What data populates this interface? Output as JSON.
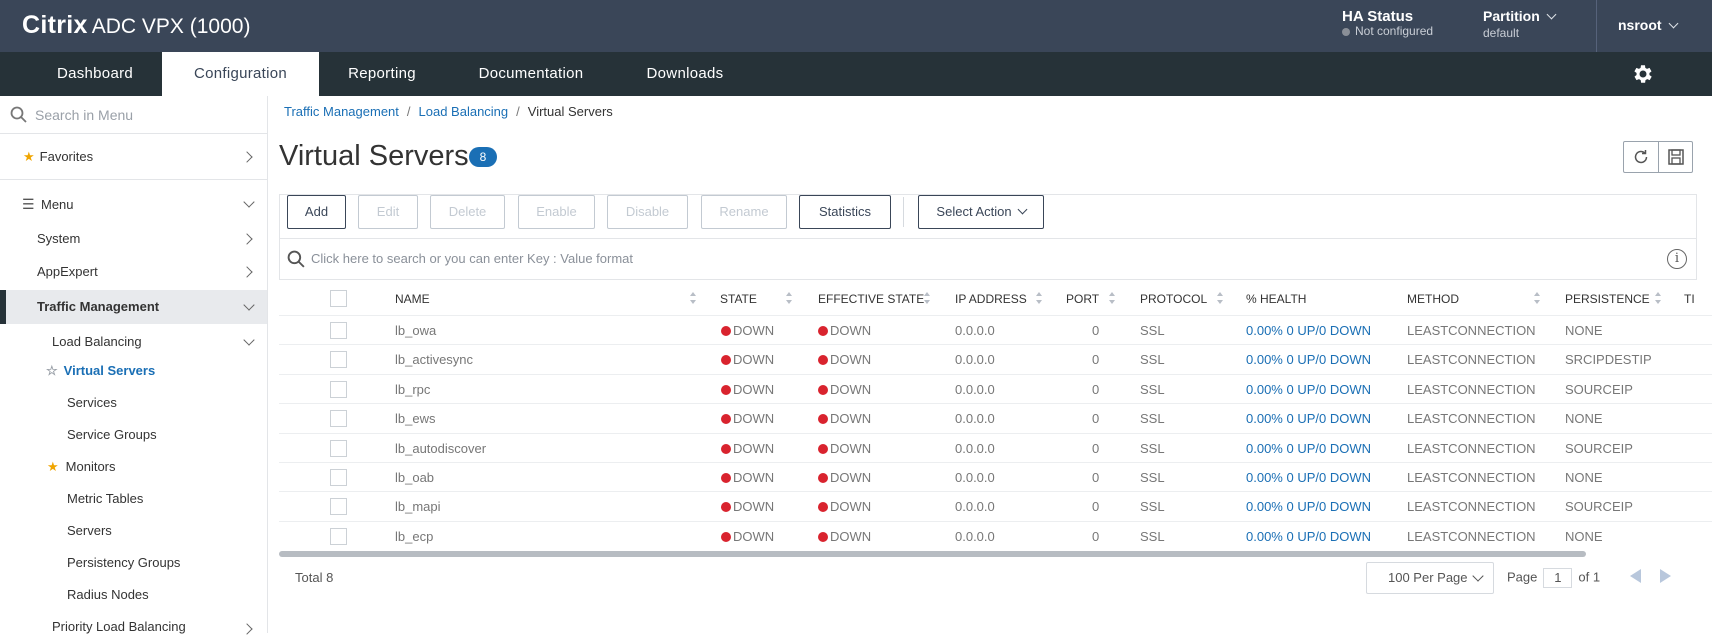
{
  "header": {
    "brand_bold": "Citrix",
    "brand_rest": "ADC VPX (1000)",
    "ha_title": "HA Status",
    "ha_value": "Not configured",
    "partition_title": "Partition",
    "partition_value": "default",
    "user": "nsroot"
  },
  "nav": {
    "tabs": [
      {
        "label": "Dashboard"
      },
      {
        "label": "Configuration"
      },
      {
        "label": "Reporting"
      },
      {
        "label": "Documentation"
      },
      {
        "label": "Downloads"
      }
    ],
    "active": "Configuration"
  },
  "sidebar": {
    "search_placeholder": "Search in Menu",
    "favorites": "Favorites",
    "menu": "Menu",
    "items": [
      {
        "label": "System"
      },
      {
        "label": "AppExpert"
      },
      {
        "label": "Traffic Management"
      },
      {
        "label": "Load Balancing"
      },
      {
        "label": "Virtual Servers"
      },
      {
        "label": "Services"
      },
      {
        "label": "Service Groups"
      },
      {
        "label": "Monitors"
      },
      {
        "label": "Metric Tables"
      },
      {
        "label": "Servers"
      },
      {
        "label": "Persistency Groups"
      },
      {
        "label": "Radius Nodes"
      },
      {
        "label": "Priority Load Balancing"
      }
    ]
  },
  "breadcrumb": {
    "items": [
      "Traffic Management",
      "Load Balancing",
      "Virtual Servers"
    ],
    "separator": "/"
  },
  "page": {
    "title": "Virtual Servers",
    "count": "8"
  },
  "toolbar": {
    "add": "Add",
    "edit": "Edit",
    "delete": "Delete",
    "enable": "Enable",
    "disable": "Disable",
    "rename": "Rename",
    "statistics": "Statistics",
    "select_action": "Select Action"
  },
  "search": {
    "placeholder": "Click here to search or you can enter Key : Value format"
  },
  "table": {
    "columns": [
      "NAME",
      "STATE",
      "EFFECTIVE STATE",
      "IP ADDRESS",
      "PORT",
      "PROTOCOL",
      "% HEALTH",
      "METHOD",
      "PERSISTENCE",
      "TI"
    ],
    "rows": [
      {
        "name": "lb_owa",
        "state": "DOWN",
        "effective_state": "DOWN",
        "ip": "0.0.0.0",
        "port": "0",
        "protocol": "SSL",
        "health": "0.00% 0 UP/0 DOWN",
        "method": "LEASTCONNECTION",
        "persistence": "NONE"
      },
      {
        "name": "lb_activesync",
        "state": "DOWN",
        "effective_state": "DOWN",
        "ip": "0.0.0.0",
        "port": "0",
        "protocol": "SSL",
        "health": "0.00% 0 UP/0 DOWN",
        "method": "LEASTCONNECTION",
        "persistence": "SRCIPDESTIP"
      },
      {
        "name": "lb_rpc",
        "state": "DOWN",
        "effective_state": "DOWN",
        "ip": "0.0.0.0",
        "port": "0",
        "protocol": "SSL",
        "health": "0.00% 0 UP/0 DOWN",
        "method": "LEASTCONNECTION",
        "persistence": "SOURCEIP"
      },
      {
        "name": "lb_ews",
        "state": "DOWN",
        "effective_state": "DOWN",
        "ip": "0.0.0.0",
        "port": "0",
        "protocol": "SSL",
        "health": "0.00% 0 UP/0 DOWN",
        "method": "LEASTCONNECTION",
        "persistence": "NONE"
      },
      {
        "name": "lb_autodiscover",
        "state": "DOWN",
        "effective_state": "DOWN",
        "ip": "0.0.0.0",
        "port": "0",
        "protocol": "SSL",
        "health": "0.00% 0 UP/0 DOWN",
        "method": "LEASTCONNECTION",
        "persistence": "SOURCEIP"
      },
      {
        "name": "lb_oab",
        "state": "DOWN",
        "effective_state": "DOWN",
        "ip": "0.0.0.0",
        "port": "0",
        "protocol": "SSL",
        "health": "0.00% 0 UP/0 DOWN",
        "method": "LEASTCONNECTION",
        "persistence": "NONE"
      },
      {
        "name": "lb_mapi",
        "state": "DOWN",
        "effective_state": "DOWN",
        "ip": "0.0.0.0",
        "port": "0",
        "protocol": "SSL",
        "health": "0.00% 0 UP/0 DOWN",
        "method": "LEASTCONNECTION",
        "persistence": "SOURCEIP"
      },
      {
        "name": "lb_ecp",
        "state": "DOWN",
        "effective_state": "DOWN",
        "ip": "0.0.0.0",
        "port": "0",
        "protocol": "SSL",
        "health": "0.00% 0 UP/0 DOWN",
        "method": "LEASTCONNECTION",
        "persistence": "NONE"
      }
    ]
  },
  "footer": {
    "total_label": "Total",
    "total": "8",
    "per_page": "100 Per Page",
    "page_label": "Page",
    "page": "1",
    "of_label": "of 1"
  },
  "colors": {
    "header_bg": "#3a4658",
    "nav_bg": "#263238",
    "accent": "#1a6fb5",
    "status_down": "#d9232e",
    "favorite_star": "#f0a500"
  },
  "icons": [
    "search-icon",
    "chevron-down-icon",
    "gear-icon",
    "star-icon",
    "menu-list-icon",
    "refresh-icon",
    "save-icon",
    "info-icon",
    "sort-icon",
    "prev-page-icon",
    "next-page-icon"
  ]
}
